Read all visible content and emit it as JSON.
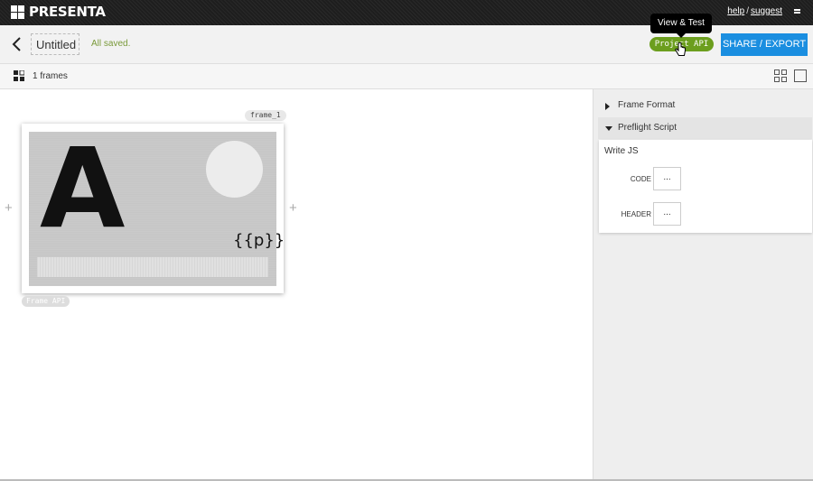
{
  "app": {
    "name": "PRESENTA"
  },
  "top_links": {
    "help": "help",
    "separator": "/",
    "suggest": "suggest"
  },
  "document": {
    "title": "Untitled",
    "save_status": "All saved."
  },
  "toolbar": {
    "project_api_label": "Project API",
    "project_api_tooltip": "View & Test",
    "share_label": "SHARE / EXPORT"
  },
  "frames_bar": {
    "count_label": "1 frames"
  },
  "frame": {
    "tag": "frame_1",
    "letter": "A",
    "param": "{{p}}",
    "api_tag": "Frame API"
  },
  "panel": {
    "frame_format_label": "Frame Format",
    "preflight_label": "Preflight Script",
    "write_js_label": "Write JS",
    "code_label": "CODE",
    "code_button": "...",
    "header_label": "HEADER",
    "header_button": "..."
  },
  "colors": {
    "topbar": "#1e1e1e",
    "api_green": "#6c9e1e",
    "share_blue": "#1a8ee0",
    "saved_green": "#7a9a3a"
  },
  "icons": [
    "logo-grid-icon",
    "menu-icon",
    "back-arrow-icon",
    "frames-icon",
    "grid-view-icon",
    "single-view-icon",
    "pointer-hand-icon",
    "add-icon",
    "caret-right-icon",
    "caret-down-icon"
  ]
}
